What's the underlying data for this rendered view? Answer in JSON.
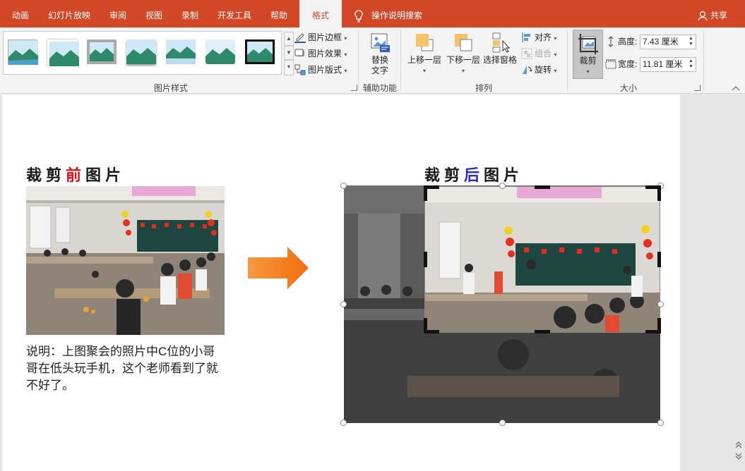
{
  "tabs": [
    {
      "label": "动画",
      "active": false
    },
    {
      "label": "幻灯片放映",
      "active": false
    },
    {
      "label": "审阅",
      "active": false
    },
    {
      "label": "视图",
      "active": false
    },
    {
      "label": "录制",
      "active": false
    },
    {
      "label": "开发工具",
      "active": false
    },
    {
      "label": "帮助",
      "active": false
    },
    {
      "label": "格式",
      "active": true
    }
  ],
  "tellme": {
    "label": "操作说明搜索",
    "icon": "lightbulb-icon"
  },
  "share": {
    "label": "共享",
    "icon": "person-icon"
  },
  "ribbon": {
    "picture_styles": {
      "group_label": "图片样式",
      "border_label": "图片边框",
      "effects_label": "图片效果",
      "layout_label": "图片版式"
    },
    "accessibility": {
      "group_label": "辅助功能",
      "alt_text_line1": "替换",
      "alt_text_line2": "文字"
    },
    "arrange": {
      "group_label": "排列",
      "bring_forward": "上移一层",
      "send_backward": "下移一层",
      "selection_pane": "选择窗格",
      "align": "对齐",
      "group": "组合",
      "rotate": "旋转"
    },
    "size": {
      "group_label": "大小",
      "crop_label": "裁剪",
      "height_label": "高度:",
      "height_value": "7.43 厘米",
      "width_label": "宽度:",
      "width_value": "11.81 厘米"
    }
  },
  "slide": {
    "title_before": {
      "part1": "裁剪",
      "highlight": "前",
      "part2": "图片"
    },
    "title_after": {
      "part1": "裁剪",
      "highlight": "后",
      "part2": "图片"
    },
    "description": "说明：上图聚会的照片中C位的小哥哥在低头玩手机，这个老师看到了就不好了。",
    "colors": {
      "before_highlight": "#e01010",
      "after_highlight": "#2a2ad8",
      "arrow": "#f47b20",
      "accent": "#d24726"
    }
  }
}
